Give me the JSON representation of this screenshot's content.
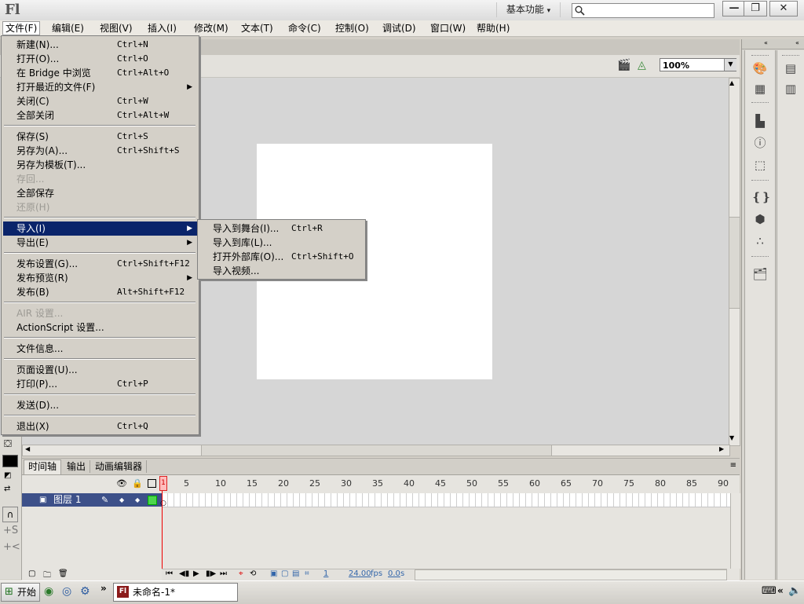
{
  "app": {
    "logo": "Fl",
    "workspace": "基本功能",
    "workspace_caret": "▾"
  },
  "window_buttons": {
    "minimize": "—",
    "restore": "❐",
    "close": "✕"
  },
  "search": {
    "value": "",
    "placeholder": ""
  },
  "menubar": [
    "文件(F)",
    "编辑(E)",
    "视图(V)",
    "插入(I)",
    "修改(M)",
    "文本(T)",
    "命令(C)",
    "控制(O)",
    "调试(D)",
    "窗口(W)",
    "帮助(H)"
  ],
  "file_menu": [
    {
      "label": "新建(N)...",
      "shortcut": "Ctrl+N"
    },
    {
      "label": "打开(O)...",
      "shortcut": "Ctrl+O"
    },
    {
      "label": "在 Bridge 中浏览",
      "shortcut": "Ctrl+Alt+O"
    },
    {
      "label": "打开最近的文件(F)",
      "shortcut": "",
      "submenu": true
    },
    {
      "label": "关闭(C)",
      "shortcut": "Ctrl+W"
    },
    {
      "label": "全部关闭",
      "shortcut": "Ctrl+Alt+W"
    },
    {
      "label": "保存(S)",
      "shortcut": "Ctrl+S"
    },
    {
      "label": "另存为(A)...",
      "shortcut": "Ctrl+Shift+S"
    },
    {
      "label": "另存为模板(T)...",
      "shortcut": ""
    },
    {
      "label": "存回...",
      "shortcut": "",
      "disabled": true
    },
    {
      "label": "全部保存",
      "shortcut": ""
    },
    {
      "label": "还原(H)",
      "shortcut": "",
      "disabled": true
    },
    {
      "label": "导入(I)",
      "shortcut": "",
      "submenu": true,
      "highlighted": true
    },
    {
      "label": "导出(E)",
      "shortcut": "",
      "submenu": true
    },
    {
      "label": "发布设置(G)...",
      "shortcut": "Ctrl+Shift+F12"
    },
    {
      "label": "发布预览(R)",
      "shortcut": "",
      "submenu": true
    },
    {
      "label": "发布(B)",
      "shortcut": "Alt+Shift+F12"
    },
    {
      "label": "AIR 设置...",
      "shortcut": "",
      "disabled": true
    },
    {
      "label": "ActionScript 设置...",
      "shortcut": ""
    },
    {
      "label": "文件信息...",
      "shortcut": ""
    },
    {
      "label": "页面设置(U)...",
      "shortcut": ""
    },
    {
      "label": "打印(P)...",
      "shortcut": "Ctrl+P"
    },
    {
      "label": "发送(D)...",
      "shortcut": ""
    },
    {
      "label": "退出(X)",
      "shortcut": "Ctrl+Q"
    }
  ],
  "import_menu": [
    {
      "label": "导入到舞台(I)...",
      "shortcut": "Ctrl+R"
    },
    {
      "label": "导入到库(L)...",
      "shortcut": ""
    },
    {
      "label": "打开外部库(O)...",
      "shortcut": "Ctrl+Shift+O"
    },
    {
      "label": "导入视频...",
      "shortcut": ""
    }
  ],
  "zoom": "100%",
  "timeline": {
    "tabs": [
      "时间轴",
      "输出",
      "动画编辑器"
    ],
    "frame_numbers": [
      "1",
      "5",
      "10",
      "15",
      "20",
      "25",
      "30",
      "35",
      "40",
      "45",
      "50",
      "55",
      "60",
      "65",
      "70",
      "75",
      "80",
      "85",
      "90"
    ],
    "layer_name": "图层 1",
    "current_frame": "1",
    "fps": "24.00",
    "fps_unit": "fps",
    "time": "0.0",
    "time_unit": "s"
  },
  "taskbar": {
    "start": "开始",
    "task_label": "未命名-1*",
    "chevron": "»"
  },
  "colors": {
    "menu_highlight": "#0a246a",
    "layer_selected": "#3d5089",
    "playhead": "#e00000"
  }
}
